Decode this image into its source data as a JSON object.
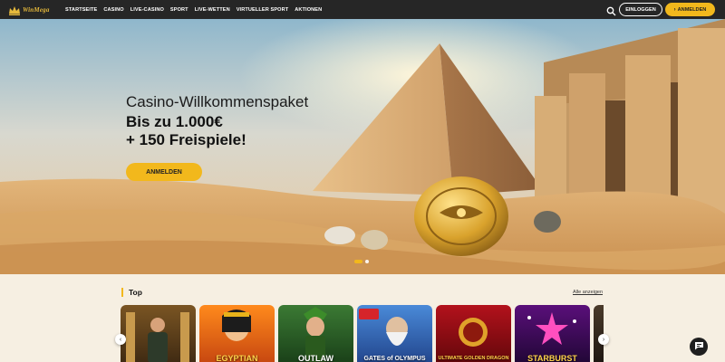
{
  "brand": {
    "logo_text": "WinMega"
  },
  "nav": {
    "items": [
      "STARTSEITE",
      "CASINO",
      "LIVE-CASINO",
      "SPORT",
      "LIVE-WETTEN",
      "VIRTUELLER SPORT",
      "AKTIONEN"
    ]
  },
  "header": {
    "login_label": "EINLOGGEN",
    "register_label": "ANMELDEN"
  },
  "hero": {
    "subtitle": "Casino-Willkommenspaket",
    "title_line1": "Bis zu 1.000€",
    "title_line2": "+ 150 Freispiele!",
    "cta_label": "ANMELDEN",
    "slides": 2,
    "active_slide": 1
  },
  "top_section": {
    "title": "Top",
    "see_all_label": "Alle anzeigen",
    "games": [
      {
        "label": ""
      },
      {
        "label": "EGYPTIAN"
      },
      {
        "label": "OUTLAW"
      },
      {
        "label": "GATES of OLYMPUS"
      },
      {
        "label": "ULTIMATE GOLDEN DRAGON"
      },
      {
        "label": "STARBURST"
      },
      {
        "label": ""
      }
    ]
  },
  "colors": {
    "accent": "#f2b81c",
    "topbar": "#262626",
    "page_bg": "#f6efe2"
  }
}
